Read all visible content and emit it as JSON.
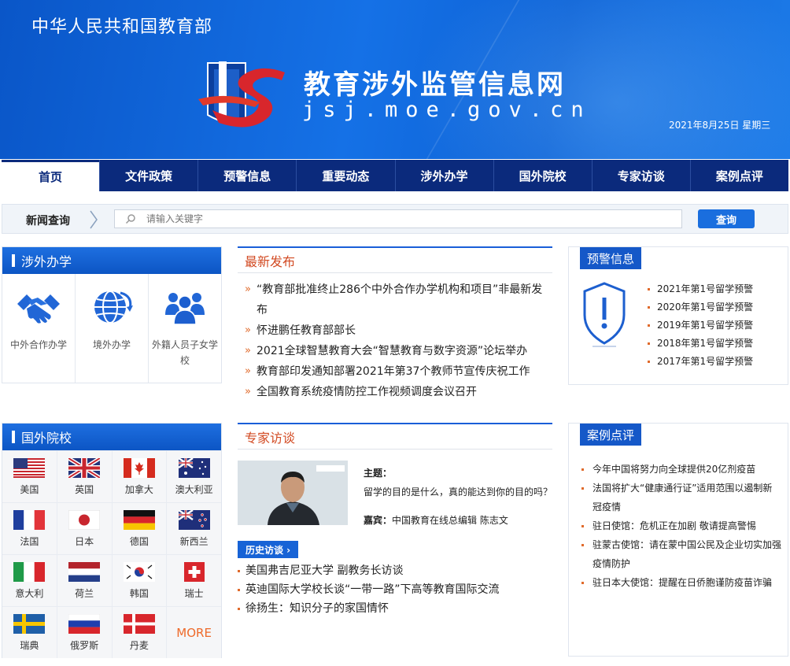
{
  "header": {
    "ministry": "中华人民共和国教育部",
    "site_title": "教育涉外监管信息网",
    "site_url": "jsj.moe.gov.cn",
    "date": "2021年8月25日  星期三"
  },
  "nav": {
    "items": [
      "首页",
      "文件政策",
      "预警信息",
      "重要动态",
      "涉外办学",
      "国外院校",
      "专家访谈",
      "案例点评"
    ],
    "active": "首页"
  },
  "search": {
    "label": "新闻查询",
    "placeholder": "请输入关键字",
    "button": "查询"
  },
  "foreign_school_panel": {
    "title": "涉外办学",
    "items": [
      {
        "label": "中外合作办学",
        "icon": "handshake-icon"
      },
      {
        "label": "境外办学",
        "icon": "globe-icon"
      },
      {
        "label": "外籍人员子女学校",
        "icon": "people-icon"
      }
    ]
  },
  "overseas_panel": {
    "title": "国外院校",
    "countries": [
      "美国",
      "英国",
      "加拿大",
      "澳大利亚",
      "法国",
      "日本",
      "德国",
      "新西兰",
      "意大利",
      "荷兰",
      "韩国",
      "瑞士",
      "瑞典",
      "俄罗斯",
      "丹麦"
    ],
    "more": "MORE"
  },
  "latest": {
    "title": "最新发布",
    "items": [
      "“教育部批准终止286个中外合作办学机构和项目”非最新发布",
      "怀进鹏任教育部部长",
      "2021全球智慧教育大会“智慧教育与数字资源”论坛举办",
      "教育部印发通知部署2021年第37个教师节宣传庆祝工作",
      "全国教育系统疫情防控工作视频调度会议召开"
    ]
  },
  "expert": {
    "title": "专家访谈",
    "topic_label": "主题：",
    "topic": "留学的目的是什么，真的能达到你的目的吗？",
    "guest_label": "嘉宾：",
    "guest": "中国教育在线总编辑 陈志文",
    "history_button": "历史访谈 ›",
    "history": [
      "美国弗吉尼亚大学 副教务长访谈",
      "英迪国际大学校长谈“一带一路”下高等教育国际交流",
      "徐扬生：知识分子的家国情怀"
    ]
  },
  "warning": {
    "title": "预警信息",
    "items": [
      "2021年第1号留学预警",
      "2020年第1号留学预警",
      "2019年第1号留学预警",
      "2018年第1号留学预警",
      "2017年第1号留学预警"
    ]
  },
  "cases": {
    "title": "案例点评",
    "items": [
      "今年中国将努力向全球提供20亿剂疫苗",
      "法国将扩大“健康通行证”适用范围以遏制新冠疫情",
      "驻日使馆：危机正在加剧 敬请提高警惕",
      "驻蒙古使馆：请在蒙中国公民及企业切实加强疫情防护",
      "驻日本大使馆：提醒在日侨胞谨防疫苗诈骗"
    ]
  },
  "colors": {
    "brand_blue": "#1571e6",
    "nav_dark": "#0b2a7c",
    "accent_orange": "#e06a2b"
  }
}
